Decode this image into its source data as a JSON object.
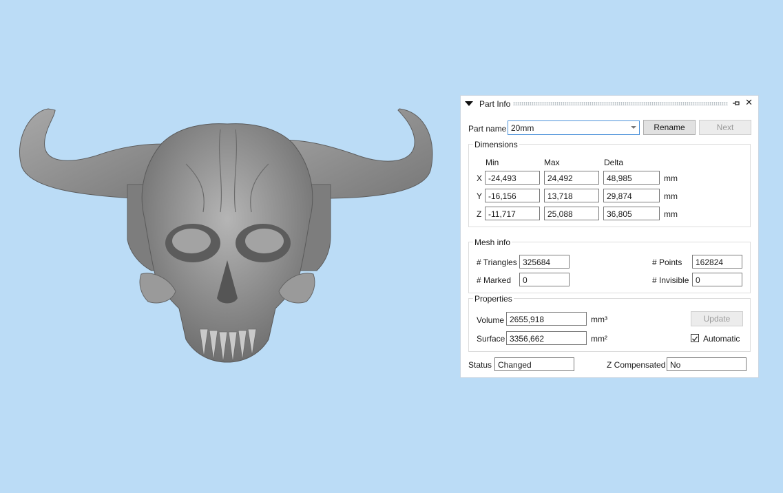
{
  "colors": {
    "background": "#bbdcf6",
    "model": "#8e8e8e"
  },
  "panel": {
    "title": "Part Info",
    "part_name_label": "Part name",
    "part_name_value": "20mm",
    "rename_button": "Rename",
    "next_button": "Next",
    "dimensions": {
      "title": "Dimensions",
      "headers": [
        "Min",
        "Max",
        "Delta"
      ],
      "unit": "mm",
      "rows": [
        {
          "axis": "X",
          "min": "-24,493",
          "max": "24,492",
          "delta": "48,985"
        },
        {
          "axis": "Y",
          "min": "-16,156",
          "max": "13,718",
          "delta": "29,874"
        },
        {
          "axis": "Z",
          "min": "-11,717",
          "max": "25,088",
          "delta": "36,805"
        }
      ]
    },
    "mesh_info": {
      "title": "Mesh info",
      "triangles_label": "# Triangles",
      "triangles_value": "325684",
      "points_label": "# Points",
      "points_value": "162824",
      "marked_label": "# Marked",
      "marked_value": "0",
      "invisible_label": "# Invisible",
      "invisible_value": "0"
    },
    "properties": {
      "title": "Properties",
      "volume_label": "Volume",
      "volume_value": "2655,918",
      "volume_unit": "mm³",
      "surface_label": "Surface",
      "surface_value": "3356,662",
      "surface_unit": "mm²",
      "update_button": "Update",
      "automatic_label": "Automatic",
      "automatic_checked": true
    },
    "status_label": "Status",
    "status_value": "Changed",
    "zcomp_label": "Z Compensated",
    "zcomp_value": "No"
  }
}
